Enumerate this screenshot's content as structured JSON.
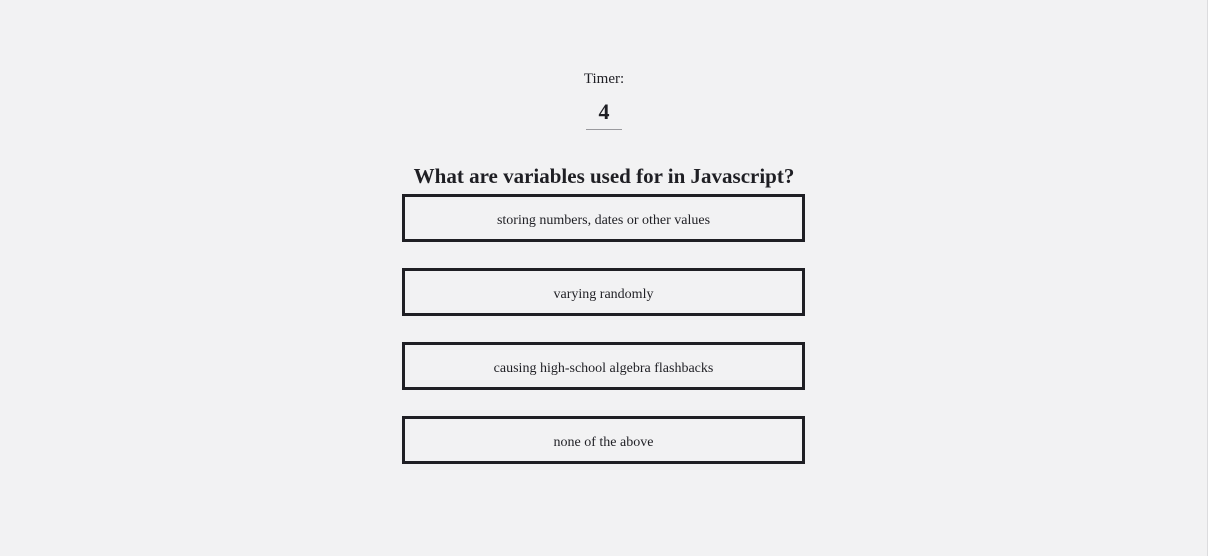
{
  "timer": {
    "label": "Timer:",
    "value": "4"
  },
  "question": {
    "text": "What are variables used for in Javascript?"
  },
  "answers": [
    {
      "label": "storing numbers, dates or other values"
    },
    {
      "label": "varying randomly"
    },
    {
      "label": "causing high-school algebra flashbacks"
    },
    {
      "label": "none of the above"
    }
  ],
  "colors": {
    "background": "#f2f2f3",
    "text": "#1f1f24",
    "border": "#1f1f24"
  }
}
